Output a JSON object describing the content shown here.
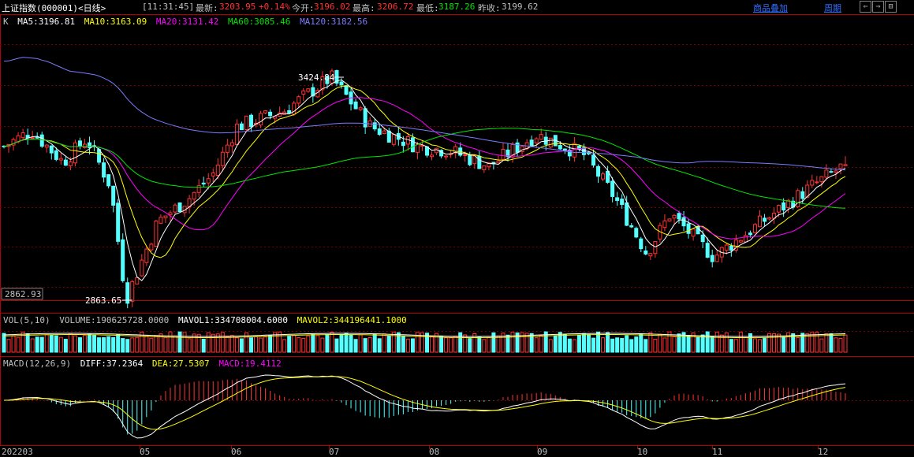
{
  "header": {
    "title": "上证指数(000001)<日线>",
    "time": "[11:31:45]",
    "latest_label": "最新:",
    "latest_value": "3203.95",
    "change": "+0.14%",
    "open_label": "今开:",
    "open_value": "3196.02",
    "high_label": "最高:",
    "high_value": "3206.72",
    "low_label": "最低:",
    "low_value": "3187.26",
    "prev_close_label": "昨收:",
    "prev_close_value": "3199.62",
    "overlay_link": "商品叠加",
    "period_link": "周期",
    "nav_buttons": [
      "⇐",
      "⇒",
      "⊟"
    ]
  },
  "colors": {
    "up": "#ff3232",
    "down": "#54ffff",
    "ma5": "#ffffff",
    "ma10": "#ffff00",
    "ma20": "#ff00ff",
    "ma60": "#00e600",
    "ma120": "#7b7bff",
    "axis": "#b40000",
    "accent_link": "#2f6fff"
  },
  "k_panel": {
    "label": "K",
    "ma_legend": [
      {
        "text": "MA5:3196.81",
        "color": "#ffffff"
      },
      {
        "text": "MA10:3163.09",
        "color": "#ffff00"
      },
      {
        "text": "MA20:3131.42",
        "color": "#ff00ff"
      },
      {
        "text": "MA60:3085.46",
        "color": "#00e600"
      },
      {
        "text": "MA120:3182.56",
        "color": "#7b7bff"
      }
    ],
    "high_annotation": "3424.84",
    "low_annotation": "2863.65",
    "price_box": "2862.93"
  },
  "vol_panel": {
    "label": "VOL(5,10)",
    "volume": "VOLUME:190625728.0000",
    "mavol1": "MAVOL1:334708004.6000",
    "mavol2": "MAVOL2:344196441.1000"
  },
  "macd_panel": {
    "label": "MACD(12,26,9)",
    "diff": "DIFF:37.2364",
    "dea": "DEA:27.5307",
    "macd": "MACD:19.4112"
  },
  "x_axis_labels": [
    "202203",
    "05",
    "06",
    "07",
    "08",
    "09",
    "10",
    "11",
    "12"
  ],
  "chart_data": {
    "type": "candlestick",
    "title": "上证指数(000001)<日线>",
    "y_range": [
      2862.93,
      3425
    ],
    "key_points": [
      {
        "x": "2022-03",
        "y": 3250
      },
      {
        "x": "2022-04",
        "y": 2863.65
      },
      {
        "x": "2022-05",
        "y": 3060
      },
      {
        "x": "2022-06",
        "y": 3300
      },
      {
        "x": "2022-07",
        "y": 3424.84
      },
      {
        "x": "2022-08",
        "y": 3250
      },
      {
        "x": "2022-09",
        "y": 3200
      },
      {
        "x": "2022-10",
        "y": 2970
      },
      {
        "x": "2022-11",
        "y": 3080
      },
      {
        "x": "2022-12",
        "y": 3203.95
      }
    ]
  }
}
